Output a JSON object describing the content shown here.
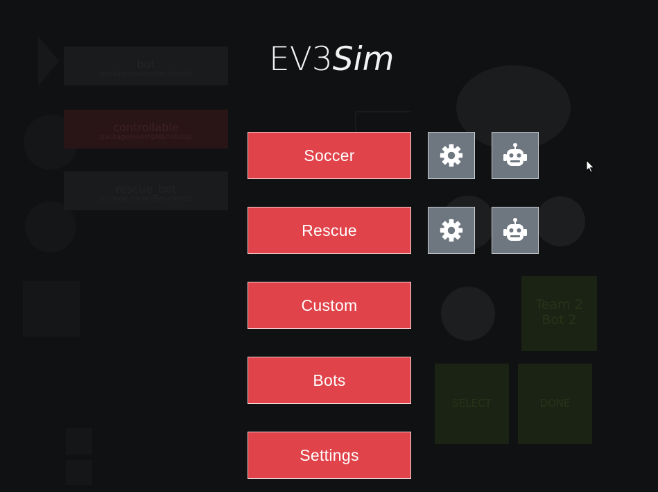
{
  "app": {
    "title_plain": "EV3",
    "title_italic": "Sim"
  },
  "menu": {
    "items": [
      {
        "label": "Soccer"
      },
      {
        "label": "Rescue"
      },
      {
        "label": "Custom"
      },
      {
        "label": "Bots"
      },
      {
        "label": "Settings"
      }
    ]
  },
  "background": {
    "bot_cards": [
      {
        "name": "bot",
        "path": "package/examples/robots/"
      },
      {
        "name": "controllable",
        "path": "package/examples/robots/"
      },
      {
        "name": "rescue_bot",
        "path": "package/examples/robots/"
      }
    ],
    "team_label_line1": "Team 2",
    "team_label_line2": "Bot 2",
    "select_label": "SELECT",
    "done_label": "DONE"
  },
  "icons": {
    "settings": "gear-icon",
    "bots": "robot-icon"
  },
  "colors": {
    "background": "#101112",
    "menu_button": "#e0434a",
    "icon_button": "#6e7780",
    "title": "#f2f2f2"
  }
}
